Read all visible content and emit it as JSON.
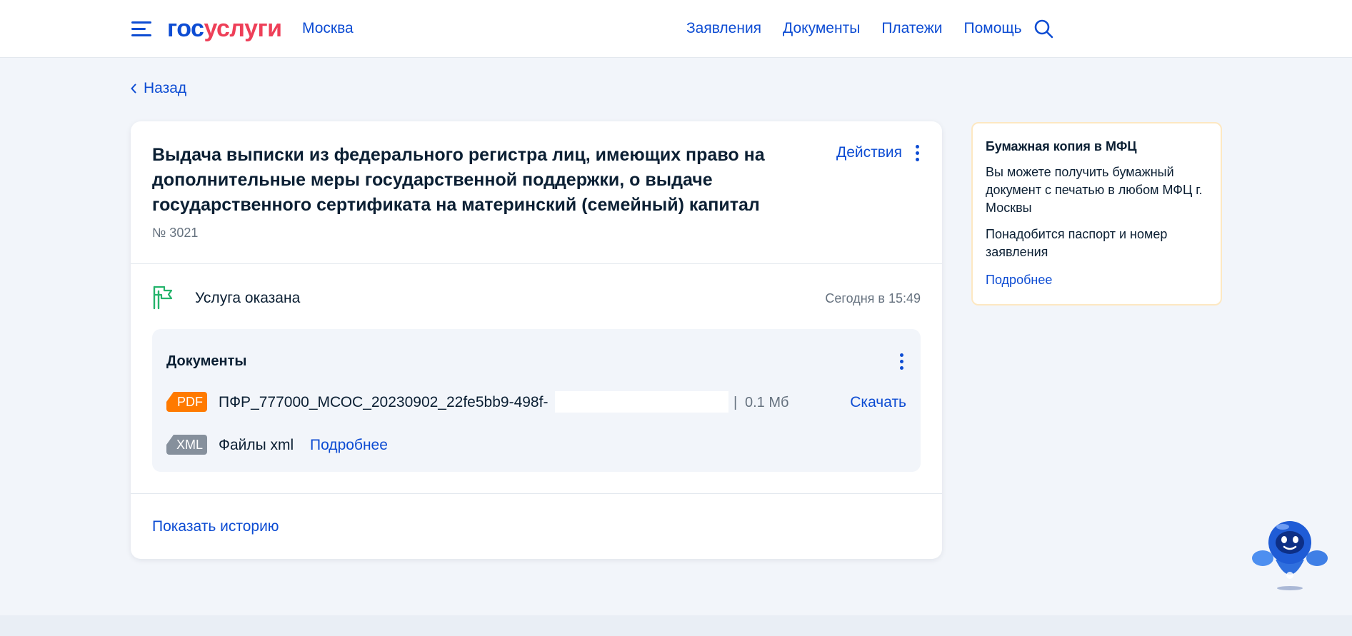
{
  "header": {
    "logo_part1": "гос",
    "logo_part2": "услуги",
    "city": "Москва",
    "nav": [
      "Заявления",
      "Документы",
      "Платежи",
      "Помощь"
    ]
  },
  "back_label": "Назад",
  "application": {
    "title": "Выдача выписки из федерального регистра лиц, имеющих право на дополнительные меры государственной поддержки, о выдаче государственного сертификата на материнский (семейный) капитал",
    "number": "№ 3021",
    "actions_label": "Действия",
    "status": "Услуга оказана",
    "status_time": "Сегодня в 15:49",
    "documents": {
      "title": "Документы",
      "pdf": {
        "badge": "PDF",
        "file_name": "ПФР_777000_МСОС_20230902_22fe5bb9-498f-",
        "separator": "|",
        "size": "0.1 Мб",
        "download_label": "Скачать"
      },
      "xml": {
        "badge": "XML",
        "label": "Файлы xml",
        "more_label": "Подробнее"
      }
    },
    "history_label": "Показать историю"
  },
  "side": {
    "title": "Бумажная копия в МФЦ",
    "text1": "Вы можете получить бумажный документ с печатью в любом МФЦ г. Москвы",
    "text2": "Понадобится паспорт и номер заявления",
    "more_label": "Подробнее"
  },
  "colors": {
    "brand_blue": "#0d4cd3",
    "brand_red": "#ee3f58",
    "status_green": "#23b36b",
    "pdf_orange": "#ff7a00",
    "xml_gray": "#86909c",
    "side_border": "#fde8c2"
  },
  "icons": {
    "menu": "menu-icon",
    "search": "search-icon",
    "back": "chevron-left-icon",
    "more": "more-vertical-icon",
    "status": "flag-icon",
    "assistant": "robot-assistant-icon"
  }
}
